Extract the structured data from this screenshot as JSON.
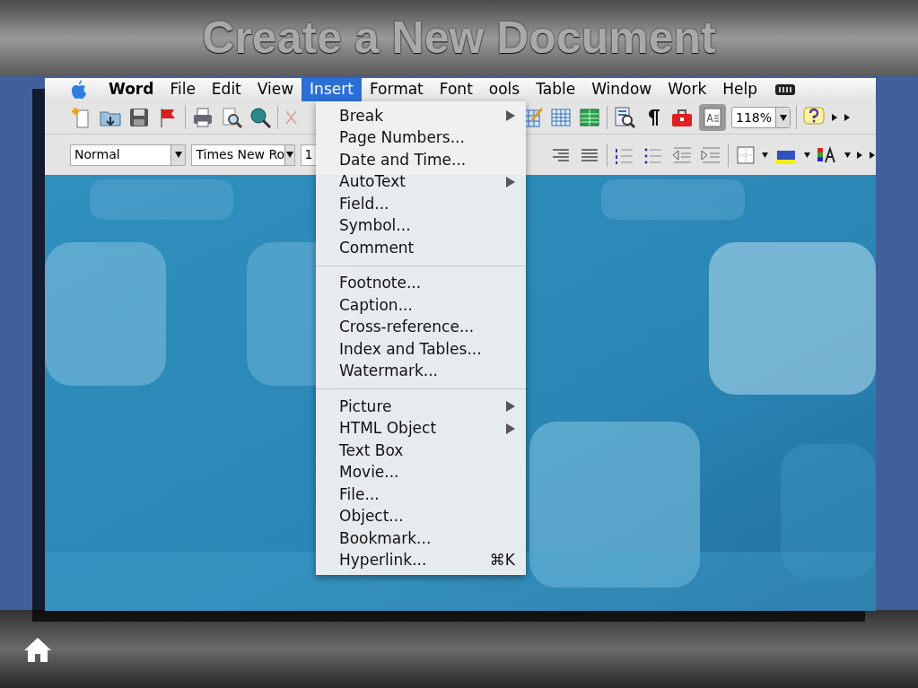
{
  "slide_title": "Create a New Document",
  "menubar": [
    {
      "label": "Word",
      "selected": false,
      "bold": true
    },
    {
      "label": "File",
      "selected": false,
      "bold": false
    },
    {
      "label": "Edit",
      "selected": false,
      "bold": false
    },
    {
      "label": "View",
      "selected": false,
      "bold": false
    },
    {
      "label": "Insert",
      "selected": true,
      "bold": false
    },
    {
      "label": "Format",
      "selected": false,
      "bold": false
    },
    {
      "label": "Font",
      "selected": false,
      "bold": false
    },
    {
      "label": "ools",
      "selected": false,
      "bold": false
    },
    {
      "label": "Table",
      "selected": false,
      "bold": false
    },
    {
      "label": "Window",
      "selected": false,
      "bold": false
    },
    {
      "label": "Work",
      "selected": false,
      "bold": false
    },
    {
      "label": "Help",
      "selected": false,
      "bold": false
    }
  ],
  "formatting": {
    "style": "Normal",
    "font": "Times New Ro",
    "size": "1",
    "zoom": "118%"
  },
  "insert_menu": [
    {
      "kind": "item",
      "label": "Break",
      "submenu": true
    },
    {
      "kind": "item",
      "label": "Page Numbers...",
      "submenu": false
    },
    {
      "kind": "item",
      "label": "Date and Time...",
      "submenu": false
    },
    {
      "kind": "item",
      "label": "AutoText",
      "submenu": true
    },
    {
      "kind": "item",
      "label": "Field...",
      "submenu": false
    },
    {
      "kind": "item",
      "label": "Symbol...",
      "submenu": false
    },
    {
      "kind": "item",
      "label": "Comment",
      "submenu": false
    },
    {
      "kind": "separator"
    },
    {
      "kind": "item",
      "label": "Footnote...",
      "submenu": false
    },
    {
      "kind": "item",
      "label": "Caption...",
      "submenu": false
    },
    {
      "kind": "item",
      "label": "Cross-reference...",
      "submenu": false
    },
    {
      "kind": "item",
      "label": "Index and Tables...",
      "submenu": false
    },
    {
      "kind": "item",
      "label": "Watermark...",
      "submenu": false
    },
    {
      "kind": "separator"
    },
    {
      "kind": "item",
      "label": "Picture",
      "submenu": true
    },
    {
      "kind": "item",
      "label": "HTML Object",
      "submenu": true
    },
    {
      "kind": "item",
      "label": "Text Box",
      "submenu": false
    },
    {
      "kind": "item",
      "label": "Movie...",
      "submenu": false
    },
    {
      "kind": "item",
      "label": "File...",
      "submenu": false
    },
    {
      "kind": "item",
      "label": "Object...",
      "submenu": false
    },
    {
      "kind": "item",
      "label": "Bookmark...",
      "submenu": false
    },
    {
      "kind": "item",
      "label": "Hyperlink...",
      "submenu": false,
      "shortcut": "⌘K"
    }
  ]
}
